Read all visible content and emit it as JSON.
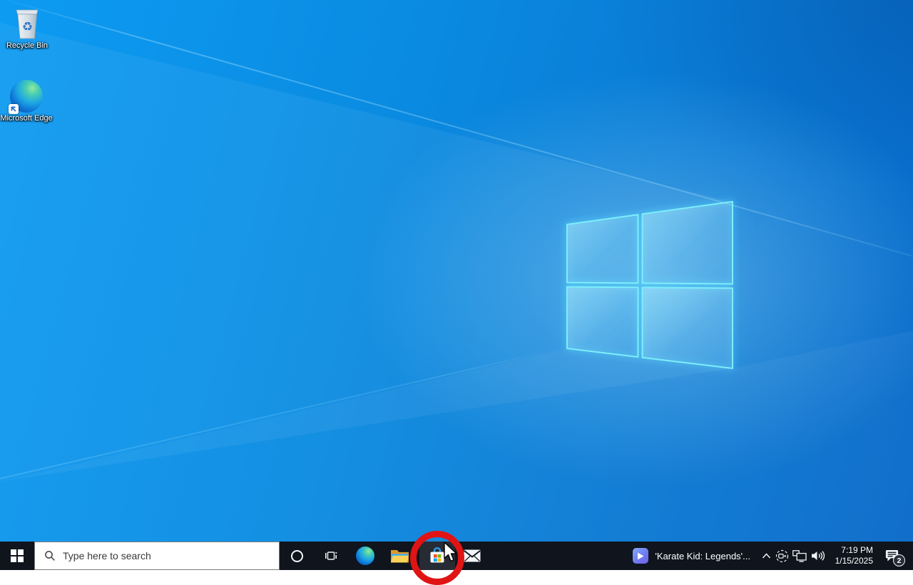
{
  "desktop": {
    "icons": [
      {
        "label": "Recycle Bin"
      },
      {
        "label": "Microsoft Edge"
      }
    ]
  },
  "taskbar": {
    "search": {
      "placeholder": "Type here to search"
    },
    "media_player": {
      "title": "'Karate Kid: Legends'..."
    },
    "clock": {
      "time": "7:19 PM",
      "date": "1/15/2025"
    },
    "action_center": {
      "badge_count": "2"
    }
  },
  "annotation": {
    "shape": "circle",
    "color": "#e01414"
  },
  "colors": {
    "taskbar_bg": "#0f141d",
    "wallpaper_base": "#0a86dd",
    "logo_edge_cyan": "#7ceefc",
    "store_squares": [
      "#f25022",
      "#7fba00",
      "#00a4ef",
      "#ffb900"
    ]
  }
}
